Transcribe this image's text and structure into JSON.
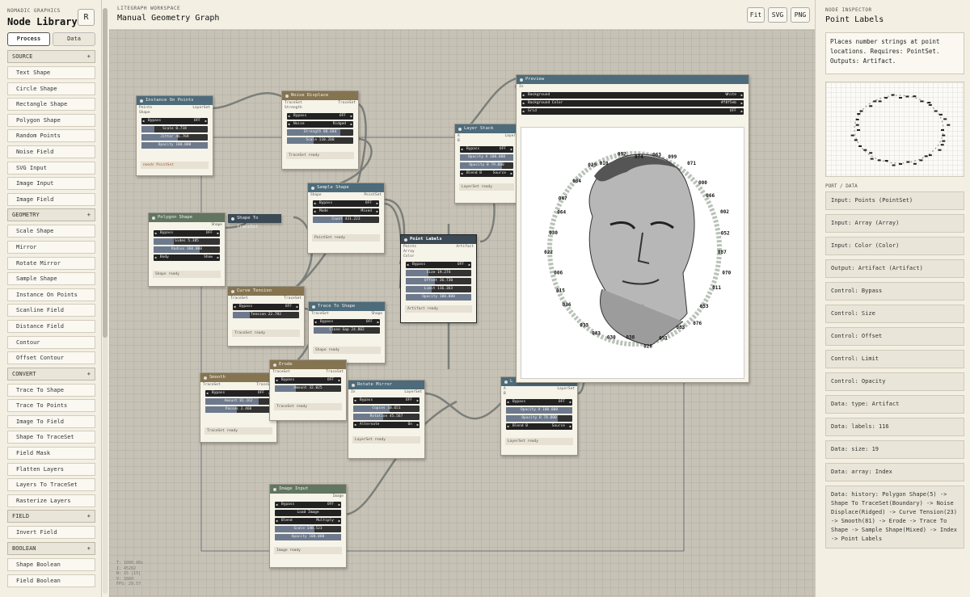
{
  "library": {
    "brand_sub": "NOMADIC GRAPHICS",
    "title": "Node Library",
    "r_button": "R",
    "tabs": [
      "Process",
      "Data"
    ],
    "categories": [
      {
        "name": "SOURCE",
        "items": [
          "Text Shape",
          "Circle Shape",
          "Rectangle Shape",
          "Polygon Shape",
          "Random Points",
          "Noise Field",
          "SVG Input",
          "Image Input",
          "Image Field"
        ]
      },
      {
        "name": "GEOMETRY",
        "items": [
          "Scale Shape",
          "Mirror",
          "Rotate Mirror",
          "Sample Shape",
          "Instance On Points",
          "Scanline Field",
          "Distance Field",
          "Contour",
          "Offset Contour"
        ]
      },
      {
        "name": "CONVERT",
        "items": [
          "Trace To Shape",
          "Trace To Points",
          "Image To Field",
          "Shape To TraceSet",
          "Field Mask",
          "Flatten Layers",
          "Layers To TraceSet",
          "Rasterize Layers"
        ]
      },
      {
        "name": "FIELD",
        "items": [
          "Invert Field"
        ]
      },
      {
        "name": "BOOLEAN",
        "items": [
          "Shape Boolean",
          "Field Boolean"
        ]
      }
    ]
  },
  "workspace": {
    "sub": "LITEGRAPH WORKSPACE",
    "title": "Manual Geometry Graph",
    "buttons": [
      "Fit",
      "SVG",
      "PNG"
    ]
  },
  "hud": [
    "T: 1090.88s",
    "I: 45282",
    "N: 15 [15]",
    "V: 1660",
    "FPS: 29.57"
  ],
  "nodes": {
    "instance": {
      "title": "Instance On Points",
      "ports_in": [
        "Points",
        "Shape"
      ],
      "port_out": "LayerSet",
      "bypass": "Bypass",
      "bypass_val": "OFF",
      "scale": "Scale 0.718",
      "jitter": "Jitter 46.769",
      "opacity": "Opacity 100.000",
      "status": "needs PointSet"
    },
    "noise": {
      "title": "Noise Displace",
      "ports_in": [
        "TraceSet",
        "Strength"
      ],
      "port_out": "TraceSet",
      "bypass": "Bypass",
      "bypass_val": "OFF",
      "noise": "Noise",
      "noise_val": "Ridged",
      "strength": "Strength 80.684",
      "scale": "Scale 110.200",
      "status": "TraceSet ready"
    },
    "sample": {
      "title": "Sample Shape",
      "port_in": "Shape",
      "port_out": "PointSet",
      "bypass": "Bypass",
      "bypass_val": "OFF",
      "mode": "Mode",
      "mode_val": "Mixed",
      "count": "Count 431.223",
      "status": "PointSet ready"
    },
    "layer": {
      "title": "Layer Stack",
      "ports_in": [
        "A",
        "B"
      ],
      "port_out": "Layer",
      "bypass": "Bypass",
      "bypass_val": "OFF",
      "opa": "Opacity A 100.000",
      "opb": "Opacity B 79.000",
      "blend": "Blend B",
      "blend_val": "Source",
      "status": "LayerSet ready"
    },
    "preview": {
      "title": "Preview",
      "port_in": "In",
      "bg": "Background",
      "bg_val": "White",
      "bgc": "Background Color",
      "bgc_val": "#f8f5eb",
      "grid": "Grid",
      "grid_val": "OFF"
    },
    "polygon": {
      "title": "Polygon Shape",
      "port_out": "Shape",
      "bypass": "Bypass",
      "bypass_val": "OFF",
      "sides": "Sides 5.385",
      "radius": "Radius 360.000",
      "body": "Body",
      "body_val": "Show",
      "status": "Shape ready"
    },
    "s2t": {
      "title": "Shape To TraceSet"
    },
    "points": {
      "title": "Point Labels",
      "ports_in": [
        "Points",
        "Array",
        "Color"
      ],
      "port_out": "Artifact",
      "bypass": "Bypass",
      "bypass_val": "OFF",
      "size": "Size 19.274",
      "offset": "Offset 26.730",
      "limit": "Limit 116.363",
      "opacity": "Opacity 100.000",
      "status": "Artifact ready"
    },
    "curve": {
      "title": "Curve Tension",
      "port_in": "TraceSet",
      "port_out": "TraceSet",
      "bypass": "Bypass",
      "bypass_val": "OFF",
      "tension": "Tension 22.792",
      "status": "TraceSet ready"
    },
    "t2s": {
      "title": "Trace To Shape",
      "port_in": "TraceSet",
      "port_out": "Shape",
      "bypass": "Bypass",
      "bypass_val": "OFF",
      "close": "Close Gap 24.802",
      "status": "Shape ready"
    },
    "smooth": {
      "title": "Smooth",
      "port_in": "TraceSet",
      "port_out": "TraceSet",
      "bypass": "Bypass",
      "bypass_val": "OFF",
      "amount": "Amount 81.162",
      "passes": "Passes 2.460",
      "status": "TraceSet ready"
    },
    "erode": {
      "title": "Erode",
      "port_in": "TraceSet",
      "port_out": "TraceSet",
      "bypass": "Bypass",
      "bypass_val": "OFF",
      "amount": "Amount 32.025",
      "status": "TraceSet ready"
    },
    "rotate": {
      "title": "Rotate Mirror",
      "port_in": "In",
      "port_out": "LayerSet",
      "bypass": "Bypass",
      "bypass_val": "OFF",
      "copies": "Copies 10.651",
      "rotation": "Rotation 45.567",
      "alt": "Alternate",
      "alt_val": "On",
      "status": "LayerSet ready"
    },
    "layer2": {
      "title": "L",
      "ports_in": [
        "A",
        "B"
      ],
      "port_out": "LayerSet",
      "bypass": "Bypass",
      "bypass_val": "OFF",
      "opa": "Opacity A 100.000",
      "opb": "Opacity B 78.000",
      "blend": "Blend B",
      "blend_val": "Source",
      "status": "LayerSet ready"
    },
    "image": {
      "title": "Image Input",
      "port_out": "Image",
      "bypass": "Bypass",
      "bypass_val": "OFF",
      "load": "Load Image",
      "blend": "Blend",
      "blend_val": "Multiply",
      "scale": "Scale 148.523",
      "opacity": "Opacity 100.000",
      "status": "Image ready"
    }
  },
  "labels": [
    "074",
    "063",
    "099",
    "071",
    "000",
    "066",
    "002",
    "052",
    "087",
    "070",
    "011",
    "053",
    "076",
    "083",
    "051",
    "028",
    "038",
    "030",
    "043",
    "033",
    "036",
    "015",
    "006",
    "022",
    "030",
    "064",
    "047",
    "084",
    "029",
    "010",
    "092"
  ],
  "inspector": {
    "sub": "NODE INSPECTOR",
    "title": "Point Labels",
    "desc": "Places number strings at point locations. Requires: PointSet. Outputs: Artifact.",
    "port_header": "PORT / DATA",
    "rows": [
      "Input: Points (PointSet)",
      "Input: Array (Array)",
      "Input: Color (Color)",
      "Output: Artifact (Artifact)",
      "Control: Bypass",
      "Control: Size",
      "Control: Offset",
      "Control: Limit",
      "Control: Opacity",
      "Data: type: Artifact",
      "Data: labels: 116",
      "Data: size: 19",
      "Data: array: Index",
      "Data: history: Polygon Shape(5) -> Shape To TraceSet(Boundary) -> Noise Displace(Ridged) -> Curve Tension(23) -> Smooth(81) -> Erode -> Trace To Shape -> Sample Shape(Mixed) -> Index -> Point Labels"
    ]
  }
}
